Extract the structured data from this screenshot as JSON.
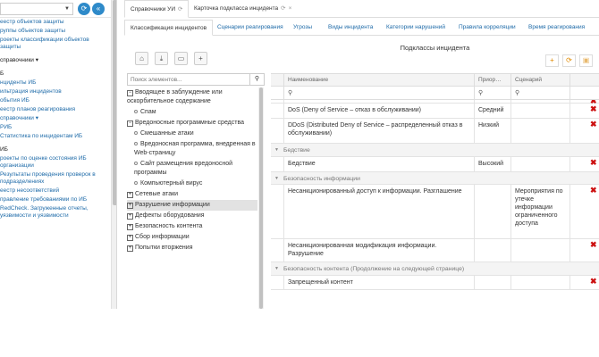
{
  "leftnav": {
    "select_value": "",
    "items": [
      {
        "label": "еестр объектов защиты",
        "style": ""
      },
      {
        "label": "руппы объектов защиты",
        "style": ""
      },
      {
        "label": "роекты классификации объектов защиты",
        "style": "wrap"
      },
      {
        "label": "справочники",
        "style": "blk caret"
      },
      {
        "label": "Б",
        "style": "blk"
      },
      {
        "label": "нциденты ИБ",
        "style": ""
      },
      {
        "label": "ильтрация инцидентов",
        "style": ""
      },
      {
        "label": "обытия ИБ",
        "style": ""
      },
      {
        "label": "еестр планов реагирования",
        "style": ""
      },
      {
        "label": "справочники",
        "style": "caret"
      },
      {
        "label": "РИБ",
        "style": ""
      },
      {
        "label": "Статистика по инцидентам ИБ",
        "style": ""
      },
      {
        "label": "ИБ",
        "style": "blk"
      },
      {
        "label": "роекты по оценке состояния ИБ организации",
        "style": "wrap"
      },
      {
        "label": "Результаты проведения проверок в подразделениях",
        "style": "wrap"
      },
      {
        "label": "еестр несоответствий",
        "style": ""
      },
      {
        "label": "правление требованиями по ИБ",
        "style": "wrap"
      },
      {
        "label": "RedCheck. Загруженные отчеты, уязвимости и уязвимости",
        "style": "wrap"
      }
    ]
  },
  "tabs_top": [
    {
      "label": "Справочники УИ"
    },
    {
      "label": "Карточка подкласса инцидента"
    }
  ],
  "tabs_sub": [
    {
      "label": "Классификация инцидентов"
    },
    {
      "label": "Сценарии реагирования"
    },
    {
      "label": "Угрозы"
    },
    {
      "label": "Виды инцидента"
    },
    {
      "label": "Категории нарушений"
    },
    {
      "label": "Правила корреляции"
    },
    {
      "label": "Время реагирования"
    }
  ],
  "tree": {
    "search_placeholder": "Поиск элементов...",
    "nodes": [
      {
        "label": "Вводящее в заблуждение или оскорбительное содержание",
        "kind": "minus",
        "level": 0
      },
      {
        "label": "Спам",
        "kind": "dot",
        "level": 1
      },
      {
        "label": "Вредоносные программные средства",
        "kind": "minus",
        "level": 0
      },
      {
        "label": "Смешанные атаки",
        "kind": "dot",
        "level": 1
      },
      {
        "label": "Вредоносная программа, внедренная в Web-страницу",
        "kind": "dot",
        "level": 1
      },
      {
        "label": "Сайт размещения вредоносной программы",
        "kind": "dot",
        "level": 1
      },
      {
        "label": "Компьютерный вирус",
        "kind": "dot",
        "level": 1
      },
      {
        "label": "Сетевые атаки",
        "kind": "plus",
        "level": 0
      },
      {
        "label": "Разрушение информации",
        "kind": "plus",
        "level": 0,
        "highlight": true
      },
      {
        "label": "Дефекты оборудования",
        "kind": "plus",
        "level": 0
      },
      {
        "label": "Безопасность контента",
        "kind": "plus",
        "level": 0
      },
      {
        "label": "Сбор информации",
        "kind": "plus",
        "level": 0
      },
      {
        "label": "Попытки вторжения",
        "kind": "plus",
        "level": 0
      }
    ]
  },
  "grid": {
    "title": "Подклассы инцидента",
    "columns": [
      "Наименование",
      "Приор…",
      "Сценарий"
    ],
    "rows": [
      {
        "type": "row",
        "name": "",
        "priority": "",
        "scenario": ""
      },
      {
        "type": "row",
        "name": "DoS (Deny of Service – отказ в обслуживании)",
        "priority": "Средний",
        "scenario": ""
      },
      {
        "type": "row",
        "name": "DDoS (Distributed Deny of Service – распределенный отказ в обслуживании)",
        "priority": "Низкий",
        "scenario": ""
      },
      {
        "type": "group",
        "name": "Бедствие"
      },
      {
        "type": "row",
        "name": "Бедствие",
        "priority": "Высокий",
        "scenario": ""
      },
      {
        "type": "group",
        "name": "Безопасность информации"
      },
      {
        "type": "row",
        "name": "Несанкционированный доступ к информации. Разглашение",
        "priority": "",
        "scenario": "Мероприятия по утечке информации ограниченного доступа"
      },
      {
        "type": "row",
        "name": "Несанкционированная модификация информации. Разрушение",
        "priority": "",
        "scenario": ""
      },
      {
        "type": "group",
        "name": "Безопасность контента (Продолжение на следующей странице)"
      },
      {
        "type": "row",
        "name": "Запрещенный контент",
        "priority": "",
        "scenario": ""
      }
    ]
  },
  "colors": {
    "accent": "#2e8ac9",
    "link": "#1d6aa8",
    "delete": "#cc1111",
    "add": "#e08a00"
  }
}
